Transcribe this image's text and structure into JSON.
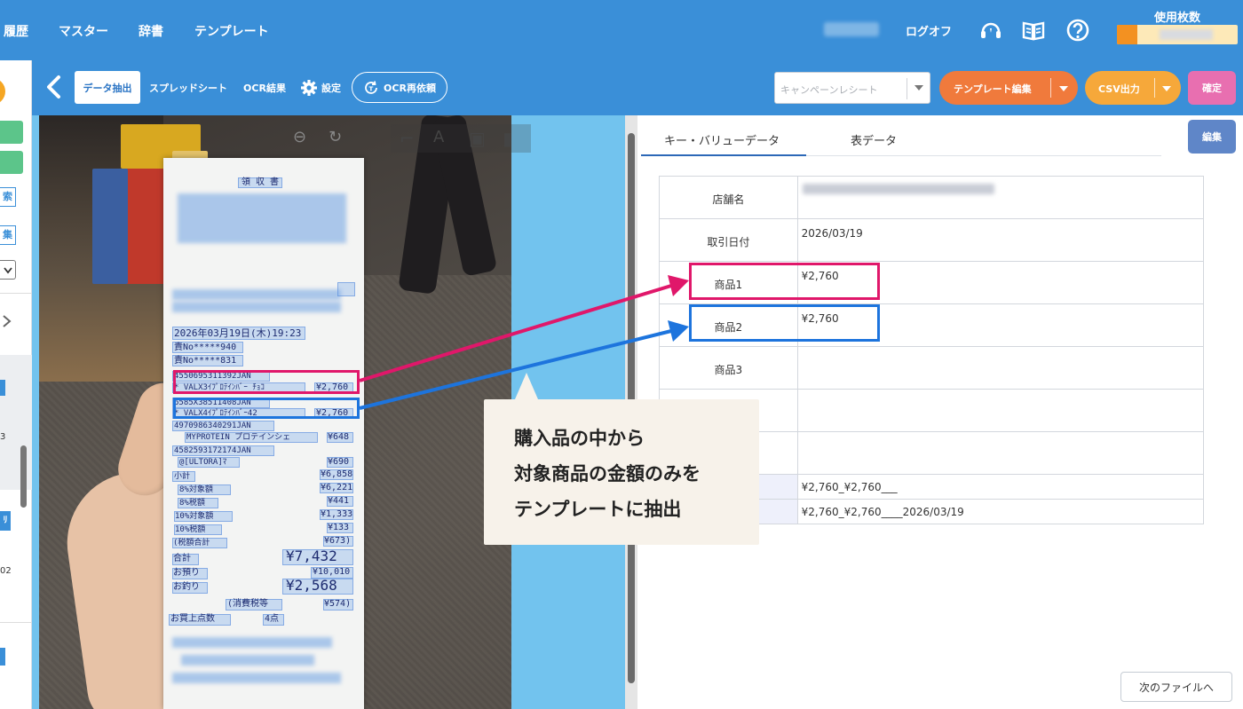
{
  "nav": {
    "items": [
      "履歴",
      "マスター",
      "辞書",
      "テンプレート"
    ],
    "logoff": "ログオフ",
    "usage_label": "使用枚数",
    "usage_fraction": 0.17,
    "icons": [
      "headset-icon",
      "manual-book-icon",
      "help-icon"
    ]
  },
  "toolbar": {
    "tabs": [
      "データ抽出",
      "スプレッドシート",
      "OCR結果"
    ],
    "settings": "設定",
    "ocr_retry": "OCR再依頼",
    "template_select_placeholder": "キャンペーンレシート",
    "template_edit": "テンプレート編集",
    "csv_output": "CSV出力",
    "confirm": "確定"
  },
  "sidebar_stub": {
    "labels": [
      "索",
      "集",
      "3",
      "02"
    ]
  },
  "receipt": {
    "title": "領 収 書",
    "lines": [
      "2026年03月19日(木)19:23",
      "責No*****940",
      "責No*****831",
      "4550695311392JAN",
      "* VALX3ｲﾌﾟﾛﾃｲﾝﾊﾞｰ ﾁｮｺ",
      "¥2,760",
      "6585X38511408JAN",
      "* VALX4ｲﾌﾟﾛﾃｲﾝﾊﾞｰ42",
      "¥2,760",
      "4970986340291JAN",
      "MYPROTEIN プロテインシェ",
      "¥648",
      "4582593172174JAN",
      "@[ULTORA]ﾏ",
      "¥690",
      "小計",
      "¥6,858",
      "8%対象額",
      "¥6,221",
      "8%税額",
      "¥441",
      "10%対象額",
      "¥1,333",
      "10%税額",
      "¥133",
      "(税額合計",
      "¥673)",
      "合計",
      "¥7,432",
      "お預り",
      "¥10,010",
      "お釣り",
      "¥2,568",
      "(消費税等",
      "¥574)",
      "お買上点数",
      "4点"
    ]
  },
  "right": {
    "tabs": [
      "キー・バリューデータ",
      "表データ"
    ],
    "edit": "編集",
    "rows": [
      {
        "key": "店舗名",
        "value": ""
      },
      {
        "key": "取引日付",
        "value": "2026/03/19"
      },
      {
        "key": "商品1",
        "value": "¥2,760"
      },
      {
        "key": "商品2",
        "value": "¥2,760"
      },
      {
        "key": "商品3",
        "value": ""
      },
      {
        "key": "",
        "value": ""
      },
      {
        "key": "",
        "value": ""
      }
    ],
    "concat1": "¥2,760_¥2,760___",
    "concat2": "¥2,760_¥2,760____2026/03/19",
    "next_file": "次のファイルへ"
  },
  "callout": {
    "lines": [
      "購入品の中から",
      "対象商品の金額のみを",
      "テンプレートに抽出"
    ]
  },
  "colors": {
    "header_blue": "#3a8fd8",
    "template_orange": "#f07a3c",
    "csv_orange": "#f6a83a",
    "confirm_pink": "#e86fb0",
    "highlight_red": "#e0176a",
    "highlight_blue": "#1d74dd"
  }
}
